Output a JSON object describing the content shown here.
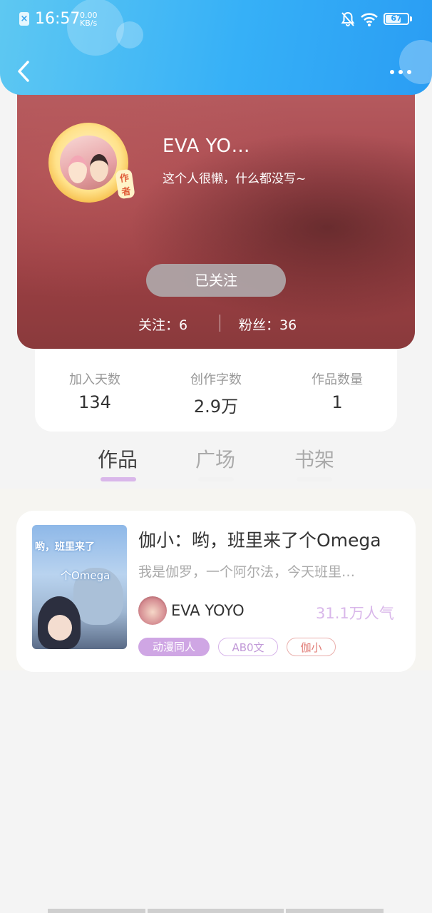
{
  "status_bar": {
    "time": "16:57",
    "net_speed_value": "0.00",
    "net_speed_unit": "KB/s",
    "battery": "67"
  },
  "profile": {
    "name": "EVA YO…",
    "bio": "这个人很懒，什么都没写~",
    "avatar_badge": "作者",
    "follow_button_label": "已关注",
    "following_text": "关注：6",
    "fans_text": "粉丝：36"
  },
  "stats": [
    {
      "label": "加入天数",
      "value": "134"
    },
    {
      "label": "创作字数",
      "value": "2.9万"
    },
    {
      "label": "作品数量",
      "value": "1"
    }
  ],
  "tabs": [
    {
      "label": "作品",
      "active": true
    },
    {
      "label": "广场",
      "active": false
    },
    {
      "label": "书架",
      "active": false
    }
  ],
  "works": [
    {
      "title": "伽小：哟，班里来了个Omega",
      "description": "我是伽罗，一个阿尔法，今天班里…",
      "author": "EVA YOYO",
      "popularity": "31.1万人气",
      "cover_title": "哟，班里来了",
      "cover_subtitle": "个Omega",
      "tags": [
        "动漫同人",
        "AB0文",
        "伽小"
      ]
    }
  ],
  "colors": {
    "header_blue": "#36b0f7",
    "accent_purple": "#d9b7ea",
    "tag_red": "#e07a74"
  }
}
